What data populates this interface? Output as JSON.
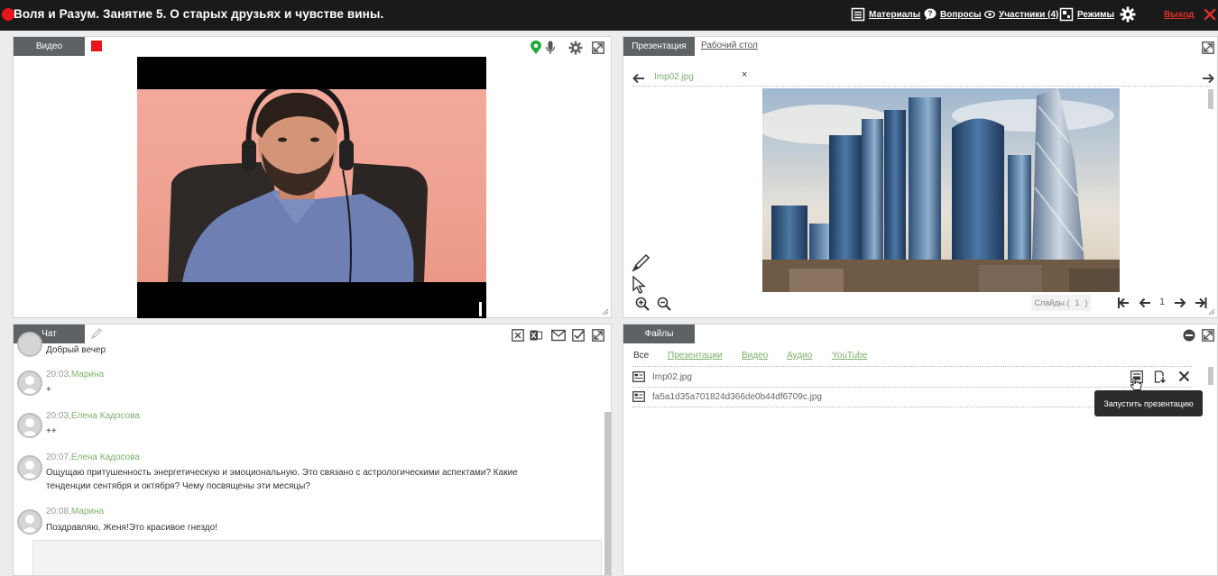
{
  "header": {
    "title": "Воля и Разум. Занятие 5. О старых друзьях и чувстве вины.",
    "nav": {
      "materials": "Материалы",
      "questions": "Вопросы",
      "participants": "Участники (4)",
      "modes": "Режимы",
      "exit": "Выход"
    }
  },
  "video_panel": {
    "tab": "Видео",
    "status_color": "#e8141a",
    "mic_status_color": "#1faa3a"
  },
  "presentation_panel": {
    "tabs": [
      "Презентация",
      "Рабочий стол"
    ],
    "slide_name": "Imp02.jpg",
    "slide_close": "×",
    "slides_label": "Слайды (",
    "slides_count": "1",
    "slides_close_paren": ")",
    "current_page": "1"
  },
  "chat_panel": {
    "tab": "Чат",
    "messages": [
      {
        "time": "",
        "author": "",
        "text": "Добрый вечер"
      },
      {
        "time": "20:03,",
        "author": "Марина",
        "text": "+"
      },
      {
        "time": "20:03,",
        "author": "Елена Кадосова",
        "text": "++"
      },
      {
        "time": "20:07,",
        "author": "Елена Кадосова",
        "text": "Ощущаю притушенность энергетическую и эмоциональную. Это связано с астрологическими аспектами? Какие тенденции сентября и октября? Чему посвящены эти месяцы?"
      },
      {
        "time": "20:08,",
        "author": "Марина",
        "text": "Поздравляю, Женя!Это красивое гнездо!"
      }
    ]
  },
  "files_panel": {
    "tab": "Файлы",
    "filters": [
      "Все",
      "Презентации",
      "Видео",
      "Аудио",
      "YouTube"
    ],
    "files": [
      "Imp02.jpg",
      "fa5a1d35a701824d366de0b44df6709c.jpg"
    ],
    "tooltip": "Запустить презентацию"
  },
  "colors": {
    "accent_green": "#7bb06a",
    "tab_gray": "#5e6266",
    "topbar": "#1a1a1a"
  }
}
